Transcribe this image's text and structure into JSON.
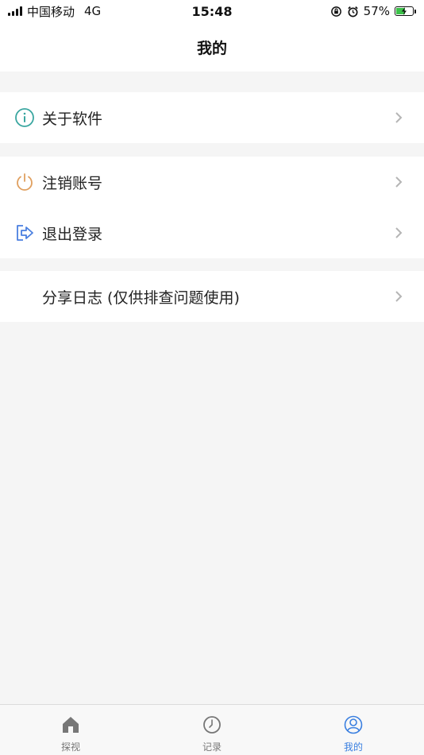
{
  "status_bar": {
    "carrier": "中国移动",
    "network": "4G",
    "time": "15:48",
    "battery": "57%",
    "battery_level": 0.57
  },
  "header": {
    "title": "我的"
  },
  "menu": {
    "about": {
      "label": "关于软件",
      "icon": "info-icon"
    },
    "deactivate": {
      "label": "注销账号",
      "icon": "power-icon"
    },
    "logout": {
      "label": "退出登录",
      "icon": "logout-icon"
    },
    "share_log": {
      "label": "分享日志 (仅供排查问题使用)"
    }
  },
  "tabbar": {
    "tabs": [
      {
        "label": "探视",
        "icon": "home-icon"
      },
      {
        "label": "记录",
        "icon": "clock-icon"
      },
      {
        "label": "我的",
        "icon": "profile-icon",
        "active": true
      }
    ]
  },
  "colors": {
    "accent": "#3a7fe0",
    "info_icon": "#3aa6a0",
    "power_icon": "#e0a060",
    "logout_icon": "#4a7fe0"
  }
}
